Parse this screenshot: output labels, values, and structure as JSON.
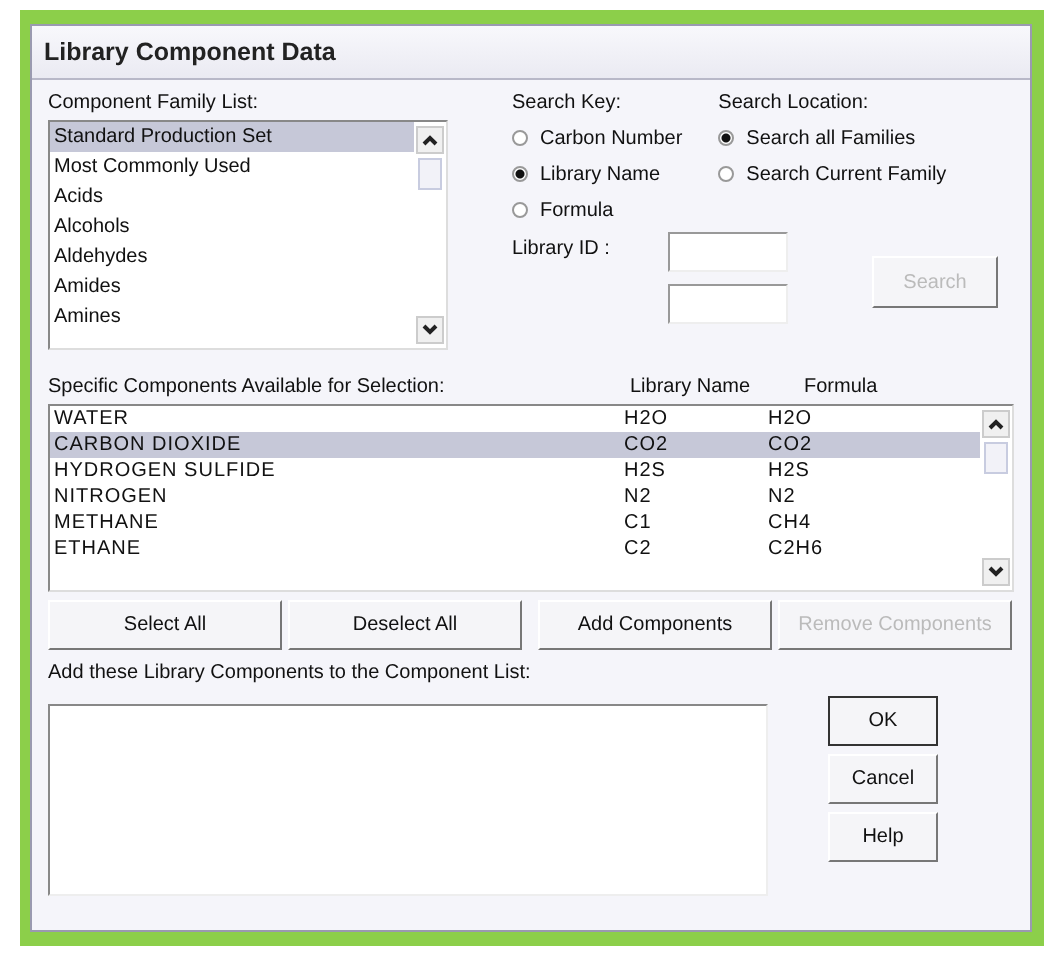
{
  "window": {
    "title": "Library Component Data"
  },
  "family_list": {
    "label": "Component Family List:",
    "items": [
      {
        "label": "Standard Production Set",
        "selected": true
      },
      {
        "label": "Most Commonly Used",
        "selected": false
      },
      {
        "label": "Acids",
        "selected": false
      },
      {
        "label": "Alcohols",
        "selected": false
      },
      {
        "label": "Aldehydes",
        "selected": false
      },
      {
        "label": "Amides",
        "selected": false
      },
      {
        "label": "Amines",
        "selected": false
      }
    ]
  },
  "search_key": {
    "label": "Search Key:",
    "options": [
      {
        "label": "Carbon Number",
        "selected": false
      },
      {
        "label": "Library Name",
        "selected": true
      },
      {
        "label": "Formula",
        "selected": false
      }
    ]
  },
  "search_location": {
    "label": "Search Location:",
    "options": [
      {
        "label": "Search all Families",
        "selected": true
      },
      {
        "label": "Search Current Family",
        "selected": false
      }
    ]
  },
  "library_id": {
    "label": "Library ID :"
  },
  "search_button": {
    "label": "Search",
    "disabled": true
  },
  "components": {
    "label": "Specific Components Available for Selection:",
    "columns": [
      "Library Name",
      "Formula"
    ],
    "rows": [
      {
        "name": "WATER",
        "library_name": "H2O",
        "formula": "H2O",
        "selected": false
      },
      {
        "name": "CARBON DIOXIDE",
        "library_name": "CO2",
        "formula": "CO2",
        "selected": true
      },
      {
        "name": "HYDROGEN SULFIDE",
        "library_name": "H2S",
        "formula": "H2S",
        "selected": false
      },
      {
        "name": "NITROGEN",
        "library_name": "N2",
        "formula": "N2",
        "selected": false
      },
      {
        "name": "METHANE",
        "library_name": "C1",
        "formula": "CH4",
        "selected": false
      },
      {
        "name": "ETHANE",
        "library_name": "C2",
        "formula": "C2H6",
        "selected": false
      }
    ]
  },
  "action_buttons": [
    {
      "label": "Select All",
      "disabled": false
    },
    {
      "label": "Deselect All",
      "disabled": false
    },
    {
      "label": "Add Components",
      "disabled": false
    },
    {
      "label": "Remove Components",
      "disabled": true
    }
  ],
  "add_list": {
    "label": "Add these Library Components to the Component List:"
  },
  "dialog_buttons": [
    {
      "label": "OK",
      "default": true
    },
    {
      "label": "Cancel",
      "default": false
    },
    {
      "label": "Help",
      "default": false
    }
  ]
}
